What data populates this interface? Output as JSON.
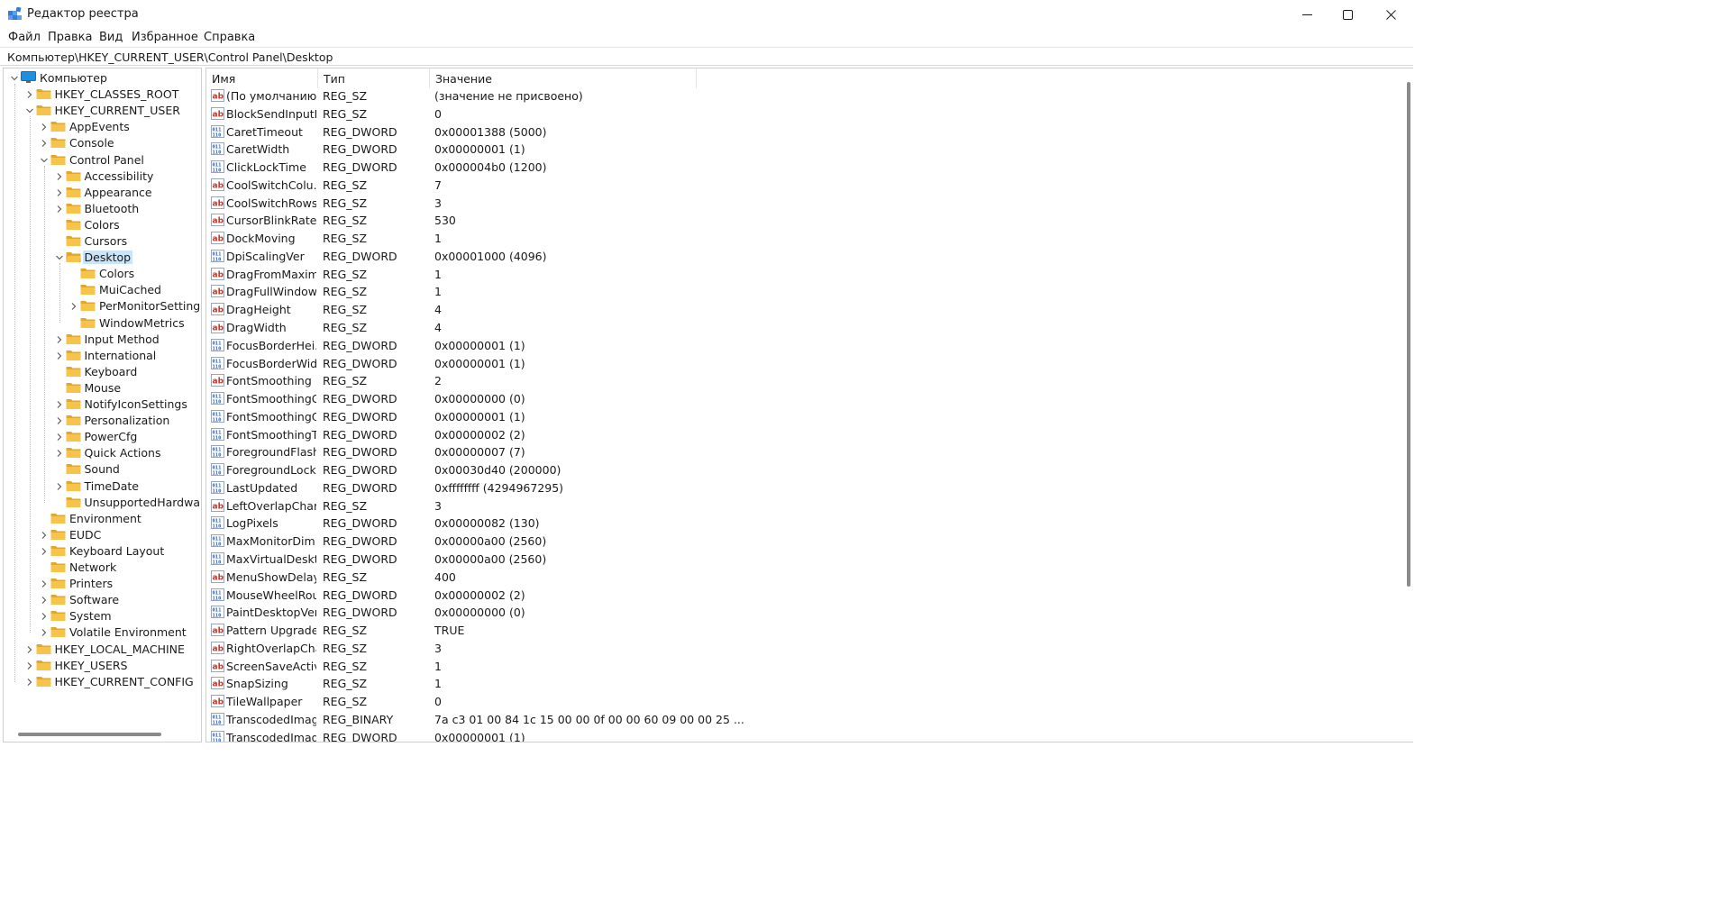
{
  "window": {
    "title": "Редактор реестра"
  },
  "menu": [
    "Файл",
    "Правка",
    "Вид",
    "Избранное",
    "Справка"
  ],
  "address": "Компьютер\\HKEY_CURRENT_USER\\Control Panel\\Desktop",
  "tree": [
    {
      "label": "Компьютер",
      "level": 0,
      "expander": "expanded",
      "icon": "computer-icon"
    },
    {
      "label": "HKEY_CLASSES_ROOT",
      "level": 1,
      "expander": "collapsed",
      "icon": "folder-icon"
    },
    {
      "label": "HKEY_CURRENT_USER",
      "level": 1,
      "expander": "expanded",
      "icon": "folder-icon"
    },
    {
      "label": "AppEvents",
      "level": 2,
      "expander": "collapsed",
      "icon": "folder-icon"
    },
    {
      "label": "Console",
      "level": 2,
      "expander": "collapsed",
      "icon": "folder-icon"
    },
    {
      "label": "Control Panel",
      "level": 2,
      "expander": "expanded",
      "icon": "folder-icon"
    },
    {
      "label": "Accessibility",
      "level": 3,
      "expander": "collapsed",
      "icon": "folder-icon"
    },
    {
      "label": "Appearance",
      "level": 3,
      "expander": "collapsed",
      "icon": "folder-icon"
    },
    {
      "label": "Bluetooth",
      "level": 3,
      "expander": "collapsed",
      "icon": "folder-icon"
    },
    {
      "label": "Colors",
      "level": 3,
      "expander": "none",
      "icon": "folder-icon"
    },
    {
      "label": "Cursors",
      "level": 3,
      "expander": "none",
      "icon": "folder-icon"
    },
    {
      "label": "Desktop",
      "level": 3,
      "expander": "expanded",
      "icon": "folder-open-icon",
      "selected": true
    },
    {
      "label": "Colors",
      "level": 4,
      "expander": "none",
      "icon": "folder-icon"
    },
    {
      "label": "MuiCached",
      "level": 4,
      "expander": "none",
      "icon": "folder-icon"
    },
    {
      "label": "PerMonitorSettings",
      "level": 4,
      "expander": "collapsed",
      "icon": "folder-icon"
    },
    {
      "label": "WindowMetrics",
      "level": 4,
      "expander": "none",
      "icon": "folder-icon"
    },
    {
      "label": "Input Method",
      "level": 3,
      "expander": "collapsed",
      "icon": "folder-icon"
    },
    {
      "label": "International",
      "level": 3,
      "expander": "collapsed",
      "icon": "folder-icon"
    },
    {
      "label": "Keyboard",
      "level": 3,
      "expander": "none",
      "icon": "folder-icon"
    },
    {
      "label": "Mouse",
      "level": 3,
      "expander": "none",
      "icon": "folder-icon"
    },
    {
      "label": "NotifyIconSettings",
      "level": 3,
      "expander": "collapsed",
      "icon": "folder-icon"
    },
    {
      "label": "Personalization",
      "level": 3,
      "expander": "collapsed",
      "icon": "folder-icon"
    },
    {
      "label": "PowerCfg",
      "level": 3,
      "expander": "collapsed",
      "icon": "folder-icon"
    },
    {
      "label": "Quick Actions",
      "level": 3,
      "expander": "collapsed",
      "icon": "folder-icon"
    },
    {
      "label": "Sound",
      "level": 3,
      "expander": "none",
      "icon": "folder-icon"
    },
    {
      "label": "TimeDate",
      "level": 3,
      "expander": "collapsed",
      "icon": "folder-icon"
    },
    {
      "label": "UnsupportedHardwareN",
      "level": 3,
      "expander": "none",
      "icon": "folder-icon"
    },
    {
      "label": "Environment",
      "level": 2,
      "expander": "none",
      "icon": "folder-icon"
    },
    {
      "label": "EUDC",
      "level": 2,
      "expander": "collapsed",
      "icon": "folder-icon"
    },
    {
      "label": "Keyboard Layout",
      "level": 2,
      "expander": "collapsed",
      "icon": "folder-icon"
    },
    {
      "label": "Network",
      "level": 2,
      "expander": "none",
      "icon": "folder-icon"
    },
    {
      "label": "Printers",
      "level": 2,
      "expander": "collapsed",
      "icon": "folder-icon"
    },
    {
      "label": "Software",
      "level": 2,
      "expander": "collapsed",
      "icon": "folder-icon"
    },
    {
      "label": "System",
      "level": 2,
      "expander": "collapsed",
      "icon": "folder-icon"
    },
    {
      "label": "Volatile Environment",
      "level": 2,
      "expander": "collapsed",
      "icon": "folder-icon"
    },
    {
      "label": "HKEY_LOCAL_MACHINE",
      "level": 1,
      "expander": "collapsed",
      "icon": "folder-icon"
    },
    {
      "label": "HKEY_USERS",
      "level": 1,
      "expander": "collapsed",
      "icon": "folder-icon"
    },
    {
      "label": "HKEY_CURRENT_CONFIG",
      "level": 1,
      "expander": "collapsed",
      "icon": "folder-icon"
    }
  ],
  "columns": {
    "name": "Имя",
    "type": "Тип",
    "value": "Значение"
  },
  "values": [
    {
      "icon": "string-value-icon",
      "name": "(По умолчанию)",
      "type": "REG_SZ",
      "data": "(значение не присвоено)"
    },
    {
      "icon": "string-value-icon",
      "name": "BlockSendInputR...",
      "type": "REG_SZ",
      "data": "0"
    },
    {
      "icon": "binary-value-icon",
      "name": "CaretTimeout",
      "type": "REG_DWORD",
      "data": "0x00001388 (5000)"
    },
    {
      "icon": "binary-value-icon",
      "name": "CaretWidth",
      "type": "REG_DWORD",
      "data": "0x00000001 (1)"
    },
    {
      "icon": "binary-value-icon",
      "name": "ClickLockTime",
      "type": "REG_DWORD",
      "data": "0x000004b0 (1200)"
    },
    {
      "icon": "string-value-icon",
      "name": "CoolSwitchColu...",
      "type": "REG_SZ",
      "data": "7"
    },
    {
      "icon": "string-value-icon",
      "name": "CoolSwitchRows",
      "type": "REG_SZ",
      "data": "3"
    },
    {
      "icon": "string-value-icon",
      "name": "CursorBlinkRate",
      "type": "REG_SZ",
      "data": "530"
    },
    {
      "icon": "string-value-icon",
      "name": "DockMoving",
      "type": "REG_SZ",
      "data": "1"
    },
    {
      "icon": "binary-value-icon",
      "name": "DpiScalingVer",
      "type": "REG_DWORD",
      "data": "0x00001000 (4096)"
    },
    {
      "icon": "string-value-icon",
      "name": "DragFromMaxim...",
      "type": "REG_SZ",
      "data": "1"
    },
    {
      "icon": "string-value-icon",
      "name": "DragFullWindows",
      "type": "REG_SZ",
      "data": "1"
    },
    {
      "icon": "string-value-icon",
      "name": "DragHeight",
      "type": "REG_SZ",
      "data": "4"
    },
    {
      "icon": "string-value-icon",
      "name": "DragWidth",
      "type": "REG_SZ",
      "data": "4"
    },
    {
      "icon": "binary-value-icon",
      "name": "FocusBorderHei...",
      "type": "REG_DWORD",
      "data": "0x00000001 (1)"
    },
    {
      "icon": "binary-value-icon",
      "name": "FocusBorderWidth",
      "type": "REG_DWORD",
      "data": "0x00000001 (1)"
    },
    {
      "icon": "string-value-icon",
      "name": "FontSmoothing",
      "type": "REG_SZ",
      "data": "2"
    },
    {
      "icon": "binary-value-icon",
      "name": "FontSmoothingG...",
      "type": "REG_DWORD",
      "data": "0x00000000 (0)"
    },
    {
      "icon": "binary-value-icon",
      "name": "FontSmoothingO...",
      "type": "REG_DWORD",
      "data": "0x00000001 (1)"
    },
    {
      "icon": "binary-value-icon",
      "name": "FontSmoothingT...",
      "type": "REG_DWORD",
      "data": "0x00000002 (2)"
    },
    {
      "icon": "binary-value-icon",
      "name": "ForegroundFlash...",
      "type": "REG_DWORD",
      "data": "0x00000007 (7)"
    },
    {
      "icon": "binary-value-icon",
      "name": "ForegroundLock...",
      "type": "REG_DWORD",
      "data": "0x00030d40 (200000)"
    },
    {
      "icon": "binary-value-icon",
      "name": "LastUpdated",
      "type": "REG_DWORD",
      "data": "0xffffffff (4294967295)"
    },
    {
      "icon": "string-value-icon",
      "name": "LeftOverlapChars",
      "type": "REG_SZ",
      "data": "3"
    },
    {
      "icon": "binary-value-icon",
      "name": "LogPixels",
      "type": "REG_DWORD",
      "data": "0x00000082 (130)"
    },
    {
      "icon": "binary-value-icon",
      "name": "MaxMonitorDim...",
      "type": "REG_DWORD",
      "data": "0x00000a00 (2560)"
    },
    {
      "icon": "binary-value-icon",
      "name": "MaxVirtualDeskt...",
      "type": "REG_DWORD",
      "data": "0x00000a00 (2560)"
    },
    {
      "icon": "string-value-icon",
      "name": "MenuShowDelay",
      "type": "REG_SZ",
      "data": "400"
    },
    {
      "icon": "binary-value-icon",
      "name": "MouseWheelRou...",
      "type": "REG_DWORD",
      "data": "0x00000002 (2)"
    },
    {
      "icon": "binary-value-icon",
      "name": "PaintDesktopVer...",
      "type": "REG_DWORD",
      "data": "0x00000000 (0)"
    },
    {
      "icon": "string-value-icon",
      "name": "Pattern Upgrade",
      "type": "REG_SZ",
      "data": "TRUE"
    },
    {
      "icon": "string-value-icon",
      "name": "RightOverlapCha...",
      "type": "REG_SZ",
      "data": "3"
    },
    {
      "icon": "string-value-icon",
      "name": "ScreenSaveActive",
      "type": "REG_SZ",
      "data": "1"
    },
    {
      "icon": "string-value-icon",
      "name": "SnapSizing",
      "type": "REG_SZ",
      "data": "1"
    },
    {
      "icon": "string-value-icon",
      "name": "TileWallpaper",
      "type": "REG_SZ",
      "data": "0"
    },
    {
      "icon": "binary-value-icon",
      "name": "TranscodedImag...",
      "type": "REG_BINARY",
      "data": "7a c3 01 00 84 1c 15 00 00 0f 00 00 60 09 00 00 25 ..."
    },
    {
      "icon": "binary-value-icon",
      "name": "TranscodedImag...",
      "type": "REG_DWORD",
      "data": "0x00000001 (1)"
    }
  ],
  "colors": {
    "selection": "#cce4f7",
    "folder": "#f6c44a",
    "folder_dark": "#e0a82e",
    "string_icon": "#c0392b",
    "binary_icon": "#2f5fb3"
  }
}
